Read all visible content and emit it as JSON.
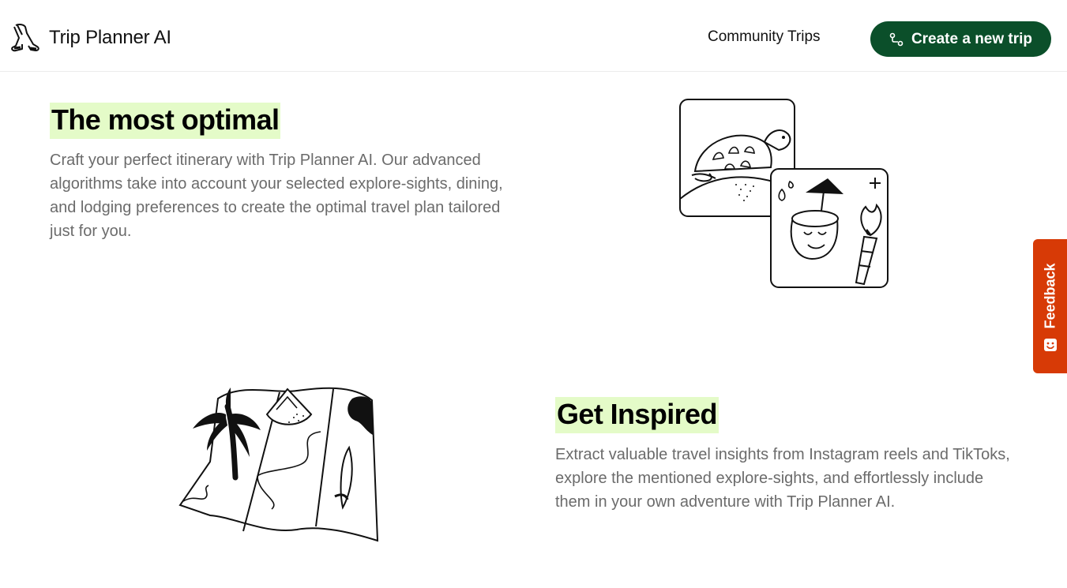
{
  "header": {
    "brand_name": "Trip Planner AI",
    "logo_icon": "walking-legs-logo-icon",
    "nav_link": "Community Trips",
    "cta_label": "Create a new trip",
    "cta_icon": "route-icon",
    "cta_color": "#0b4f2a"
  },
  "features": [
    {
      "title": "The most optimal",
      "text": "Craft your perfect itinerary with Trip Planner AI. Our advanced algorithms take into account your selected explore-sights, dining, and lodging preferences to create the optimal travel plan tailored just for you.",
      "illustration": "turtle-coconut-torch-illustration"
    },
    {
      "title": "Get Inspired",
      "text": "Extract valuable travel insights from Instagram reels and TikToks, explore the mentioned explore-sights, and effortlessly include them in your own adventure with Trip Planner AI.",
      "illustration": "folded-map-illustration"
    }
  ],
  "feedback": {
    "label": "Feedback",
    "icon": "smile-icon",
    "color": "#d73a06"
  },
  "colors": {
    "title_highlight": "#e4fbc8",
    "body_text": "#6b6b6b"
  }
}
